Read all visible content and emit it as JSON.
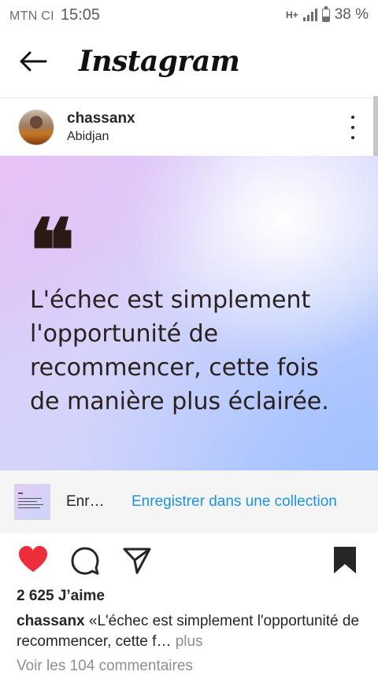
{
  "status_bar": {
    "carrier": "MTN CI",
    "time": "15:05",
    "network": "H+",
    "battery_level": 0.38,
    "battery_text": "38 %"
  },
  "top_bar": {
    "logo": "Instagram"
  },
  "post": {
    "username": "chassanx",
    "location": "Abidjan",
    "quote_mark": "❝",
    "quote_lines": [
      "L'échec est simplement",
      "l'opportunité de",
      "recommencer, cette fois",
      "de manière plus éclairée."
    ]
  },
  "save_bar": {
    "label": "Enr…",
    "collection_link": "Enregistrer dans une collection"
  },
  "engagement": {
    "likes": "2 625 J’aime",
    "caption_user": "chassanx",
    "caption_text": " «L'échec est simplement l'opportunité de recommencer, cette f… ",
    "more_label": "plus",
    "view_comments": "Voir les 104 commentaires"
  },
  "colors": {
    "accent_blue": "#1a93e0",
    "like_red": "#ed2e3a",
    "text": "#262626"
  }
}
